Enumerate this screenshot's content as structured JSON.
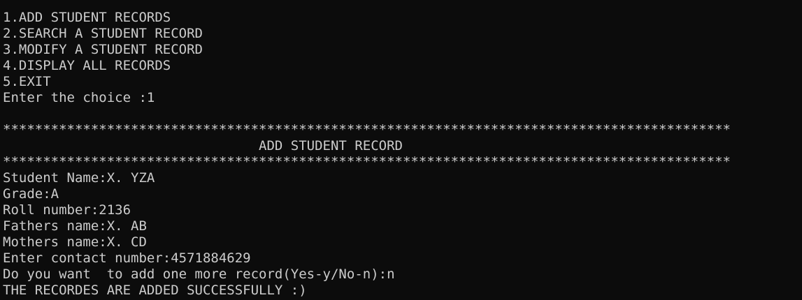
{
  "menu": [
    "1.ADD STUDENT RECORDS",
    "2.SEARCH A STUDENT RECORD",
    "3.MODIFY A STUDENT RECORD",
    "4.DISPLAY ALL RECORDS",
    "5.EXIT"
  ],
  "choice_prompt": "Enter the choice :",
  "choice_value": "1",
  "stars": "*******************************************************************************************",
  "section_title": "                                ADD STUDENT RECORD",
  "fields": [
    {
      "label": "Student Name:",
      "value": "X. YZA"
    },
    {
      "label": "Grade:",
      "value": "A"
    },
    {
      "label": "Roll number:",
      "value": "2136"
    },
    {
      "label": "Fathers name:",
      "value": "X. AB"
    },
    {
      "label": "Mothers name:",
      "value": "X. CD"
    },
    {
      "label": "Enter contact number:",
      "value": "4571884629"
    }
  ],
  "more_prompt": "Do you want  to add one more record(Yes-y/No-n):",
  "more_value": "n",
  "success_message": "THE RECORDES ARE ADDED SUCCESSFULLY :)"
}
